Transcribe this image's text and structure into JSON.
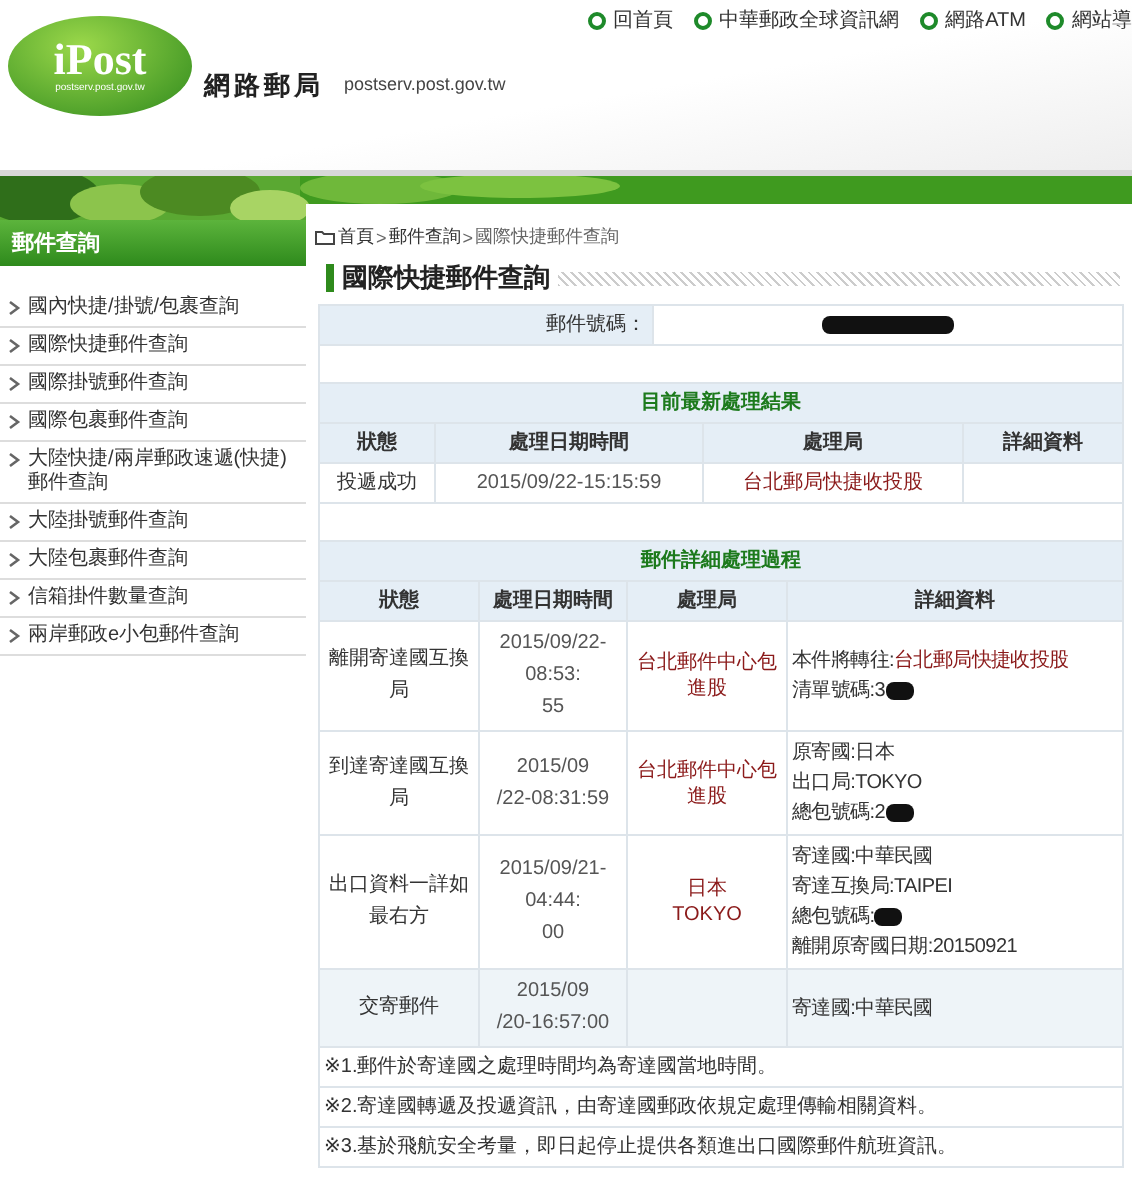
{
  "header": {
    "logo_text": "iPost",
    "logo_domain": "postserv.post.gov.tw",
    "site_title": "網路郵局",
    "site_domain": "postserv.post.gov.tw",
    "top_links": [
      "回首頁",
      "中華郵政全球資訊網",
      "網路ATM",
      "網站導"
    ]
  },
  "sidebar": {
    "title": "郵件查詢",
    "items": [
      {
        "label": "國內快捷/掛號/包裹查詢"
      },
      {
        "label": "國際快捷郵件查詢"
      },
      {
        "label": "國際掛號郵件查詢"
      },
      {
        "label": "國際包裹郵件查詢"
      },
      {
        "label": "大陸快捷/兩岸郵政速遞(快捷)郵件查詢"
      },
      {
        "label": "大陸掛號郵件查詢"
      },
      {
        "label": "大陸包裹郵件查詢"
      },
      {
        "label": "信箱掛件數量查詢"
      },
      {
        "label": "兩岸郵政e小包郵件查詢"
      }
    ]
  },
  "breadcrumb": [
    "首頁",
    "郵件查詢",
    "國際快捷郵件查詢"
  ],
  "breadcrumb_separator": ">",
  "page_title": "國際快捷郵件查詢",
  "tracking": {
    "label": "郵件號碼：",
    "redacted": true
  },
  "latest": {
    "title": "目前最新處理結果",
    "columns": [
      "狀態",
      "處理日期時間",
      "處理局",
      "詳細資料"
    ],
    "rows": [
      {
        "status": "投遞成功",
        "datetime": "2015/09/22-15:15:59",
        "office": [
          "台北郵局快捷收投股"
        ]
      }
    ]
  },
  "history": {
    "title": "郵件詳細處理過程",
    "columns": [
      "狀態",
      "處理日期時間",
      "處理局",
      "詳細資料"
    ],
    "rows": [
      {
        "status": "離開寄達國互換局",
        "datetime": [
          "2015/09/22-08:53:",
          "55"
        ],
        "office": [
          "台北郵件中心包進股"
        ],
        "shaded": false,
        "details": [
          {
            "label": "本件將轉往:",
            "value": "台北郵局快捷收投股",
            "redacted": false
          },
          {
            "label": "清單號碼:3",
            "redacted": true
          }
        ]
      },
      {
        "status": "到達寄達國互換局",
        "datetime": [
          "2015/09",
          "/22-08:31:59"
        ],
        "office": [
          "台北郵件中心包進股"
        ],
        "shaded": false,
        "details": [
          {
            "label": "原寄國:日本",
            "redacted": false
          },
          {
            "label": "出口局:TOKYO",
            "redacted": false
          },
          {
            "label": "總包號碼:2",
            "redacted": true
          }
        ]
      },
      {
        "status": "出口資料一詳如最右方",
        "datetime": [
          "2015/09/21-04:44:",
          "00"
        ],
        "office": [
          "日本",
          "TOKYO"
        ],
        "shaded": false,
        "details": [
          {
            "label": "寄達國:中華民國",
            "redacted": false
          },
          {
            "label": "寄達互換局:TAIPEI",
            "redacted": false
          },
          {
            "label": "總包號碼:",
            "redacted": true
          },
          {
            "label": "離開原寄國日期:20150921",
            "redacted": false
          }
        ]
      },
      {
        "status": "交寄郵件",
        "datetime": [
          "2015/09",
          "/20-16:57:00"
        ],
        "office": [],
        "shaded": true,
        "details": [
          {
            "label": "寄達國:中華民國",
            "redacted": false
          }
        ]
      }
    ]
  },
  "notes": [
    "※1.郵件於寄達國之處理時間均為寄達國當地時間。",
    "※2.寄達國轉遞及投遞資訊，由寄達國郵政依規定處理傳輸相關資料。",
    "※3.基於飛航安全考量，即日起停止提供各類進出口國際郵件航班資訊。"
  ]
}
